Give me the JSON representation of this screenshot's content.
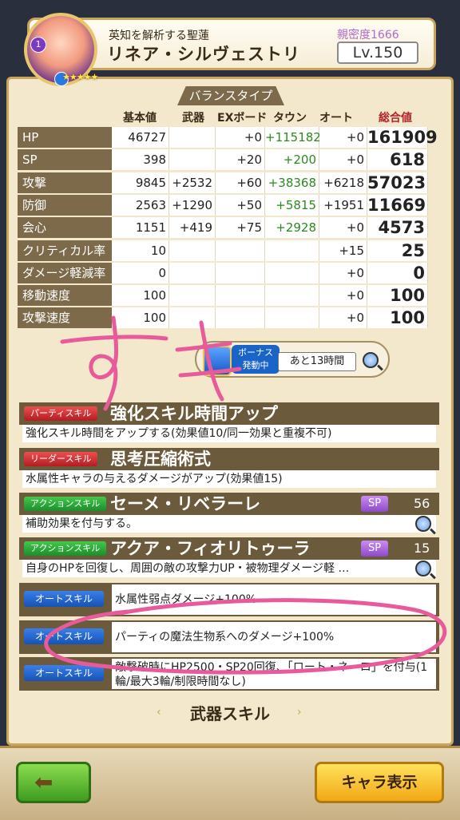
{
  "header": {
    "subtitle": "英知を解析する聖蓮",
    "name": "リネア・シルヴェストリ",
    "intimacy": "親密度1666",
    "level": "Lv.150",
    "avatar_badge": "1",
    "avatar_stars": "★★★★★"
  },
  "balance_type": "バランスタイプ",
  "stats": {
    "columns": [
      "基本値",
      "武器",
      "EXボード",
      "タウン",
      "オート",
      "総合値"
    ],
    "rows": [
      {
        "label": "HP",
        "base": "46727",
        "weapon": "",
        "ex": "+0",
        "town": "+115182",
        "auto": "+0",
        "total": "161909"
      },
      {
        "label": "SP",
        "base": "398",
        "weapon": "",
        "ex": "+20",
        "town": "+200",
        "auto": "+0",
        "total": "618"
      },
      {
        "label": "攻撃",
        "base": "9845",
        "weapon": "+2532",
        "ex": "+60",
        "town": "+38368",
        "auto": "+6218",
        "total": "57023"
      },
      {
        "label": "防御",
        "base": "2563",
        "weapon": "+1290",
        "ex": "+50",
        "town": "+5815",
        "auto": "+1951",
        "total": "11669"
      },
      {
        "label": "会心",
        "base": "1151",
        "weapon": "+419",
        "ex": "+75",
        "town": "+2928",
        "auto": "+0",
        "total": "4573"
      },
      {
        "label": "クリティカル率",
        "base": "10",
        "weapon": "",
        "ex": "",
        "town": "",
        "auto": "+15",
        "total": "25"
      },
      {
        "label": "ダメージ軽減率",
        "base": "0",
        "weapon": "",
        "ex": "",
        "town": "",
        "auto": "+0",
        "total": "0"
      },
      {
        "label": "移動速度",
        "base": "100",
        "weapon": "",
        "ex": "",
        "town": "",
        "auto": "+0",
        "total": "100"
      },
      {
        "label": "攻撃速度",
        "base": "100",
        "weapon": "",
        "ex": "",
        "town": "",
        "auto": "+0",
        "total": "100"
      }
    ]
  },
  "bonus": {
    "label": "ボーナス\n発動中",
    "time": "あと13時間"
  },
  "skills": [
    {
      "tag": "パーティスキル",
      "tag_color": "red",
      "name": "強化スキル時間アップ",
      "desc": "強化スキル時間をアップする(効果値10/同一効果と重複不可)",
      "sp": "",
      "sp_value": ""
    },
    {
      "tag": "リーダースキル",
      "tag_color": "red",
      "name": "思考圧縮術式",
      "desc": "水属性キャラの与えるダメージがアップ(効果値15)",
      "sp": "",
      "sp_value": ""
    },
    {
      "tag": "アクションスキル",
      "tag_color": "green",
      "name": "セーメ・リベラーレ",
      "desc": "補助効果を付与する。",
      "sp": "SP",
      "sp_value": "56"
    },
    {
      "tag": "アクションスキル",
      "tag_color": "green",
      "name": "アクア・フィオリトゥーラ",
      "desc": "自身のHPを回復し、周囲の敵の攻撃力UP・被物理ダメージ軽 …",
      "sp": "SP",
      "sp_value": "15"
    }
  ],
  "auto_skills": [
    {
      "tag": "オートスキル",
      "text": "水属性弱点ダメージ+100%"
    },
    {
      "tag": "オートスキル",
      "text": "パーティの魔法生物系へのダメージ+100%"
    },
    {
      "tag": "オートスキル",
      "text": "敵撃破時にHP2500・SP20回復、「ロート・ネーロ」を付与(1輪/最大3輪/制限時間なし)"
    }
  ],
  "weapon_skill": "武器スキル",
  "footer": {
    "back_icon": "arrow-left-icon",
    "chara_button": "キャラ表示"
  },
  "handwriting": "すき",
  "colors": {
    "panel": "#f3e8cc",
    "header_row": "#7c6a4a",
    "total_red": "#b2242a",
    "town_green": "#2b8a1e",
    "marker_pink": "#e85a9a"
  }
}
